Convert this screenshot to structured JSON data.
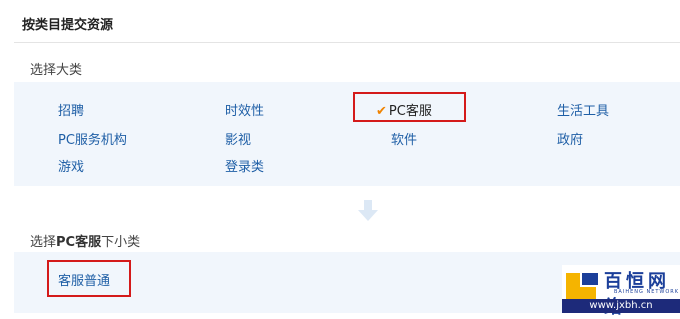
{
  "page_title": "按类目提交资源",
  "category_section": {
    "label": "选择大类",
    "items": [
      {
        "label": "招聘"
      },
      {
        "label": "时效性"
      },
      {
        "label": "PC客服",
        "selected": true
      },
      {
        "label": "生活工具"
      },
      {
        "label": "PC服务机构"
      },
      {
        "label": "影视"
      },
      {
        "label": "软件"
      },
      {
        "label": "政府"
      },
      {
        "label": "游戏"
      },
      {
        "label": "登录类"
      }
    ]
  },
  "subcategory_section": {
    "label_prefix": "选择",
    "label_selected": "PC客服",
    "label_suffix": "下小类",
    "items": [
      {
        "label": "客服普通"
      }
    ]
  },
  "watermark": {
    "name_cn": "百恒网络",
    "name_en": "BAIHENG NETWORK",
    "url": "www.jxbh.cn"
  },
  "colors": {
    "link": "#1f5fa6",
    "panel_bg": "#f1f6fc",
    "highlight_border": "#d41a1a",
    "check": "#f08300"
  },
  "icons": {
    "selected_marker": "checkmark-icon",
    "flow": "down-arrow-icon"
  }
}
